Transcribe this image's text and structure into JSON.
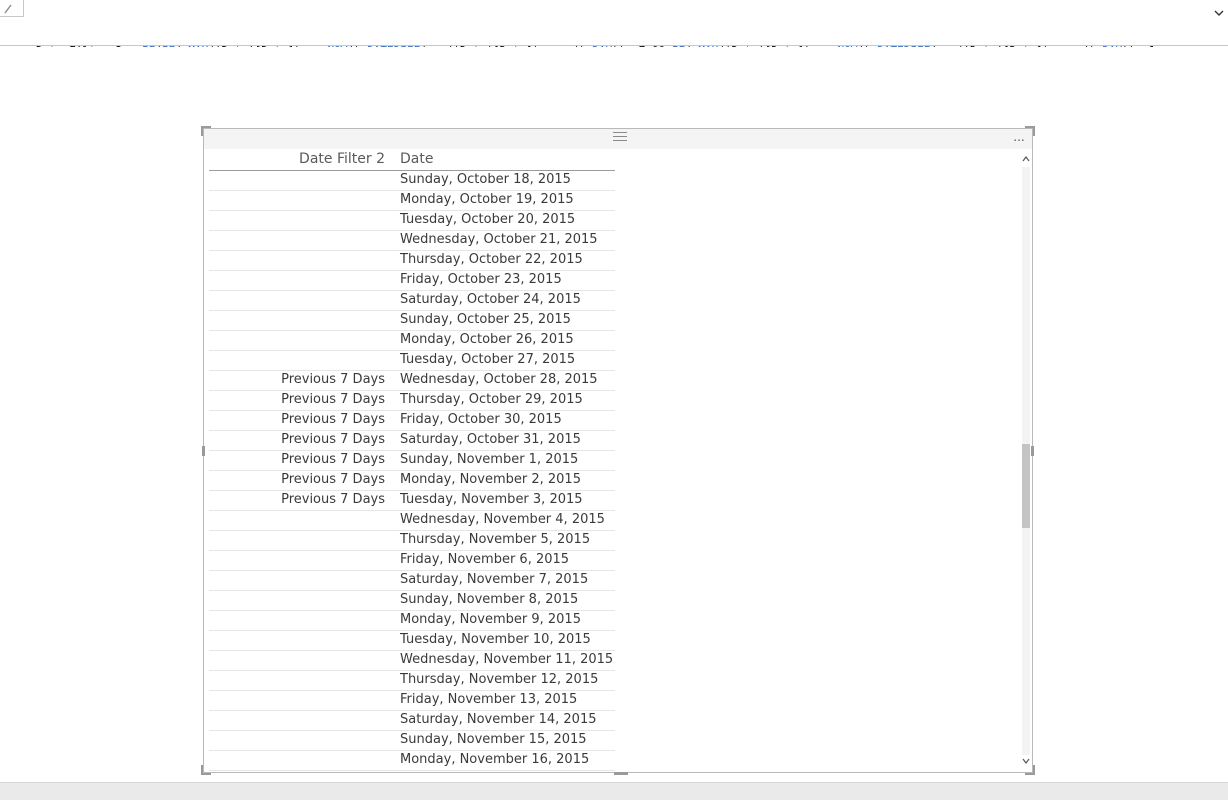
{
  "formula": {
    "line1_parts": [
      {
        "t": "Date Filter 2 = ",
        "c": "plain"
      },
      {
        "t": "IF",
        "c": "kw"
      },
      {
        "t": "(",
        "c": "plain"
      },
      {
        "t": "IF",
        "c": "kw"
      },
      {
        "t": "( ",
        "c": "plain"
      },
      {
        "t": "MAX",
        "c": "kw"
      },
      {
        "t": "('Date'[Date]) <= ",
        "c": "plain"
      },
      {
        "t": "NOW",
        "c": "kw"
      },
      {
        "t": "(),",
        "c": "plain"
      },
      {
        "t": "DATEDIFF",
        "c": "kw"
      },
      {
        "t": "(",
        "c": "plain"
      },
      {
        "t": "max",
        "c": "kw"
      },
      {
        "t": "('Date'[Date]), ",
        "c": "plain"
      },
      {
        "t": "now",
        "c": "kw"
      },
      {
        "t": "(),",
        "c": "plain"
      },
      {
        "t": "DAY",
        "c": "kw"
      },
      {
        "t": "))<=7 && ",
        "c": "plain"
      },
      {
        "t": "IF",
        "c": "kw"
      },
      {
        "t": "( ",
        "c": "plain"
      },
      {
        "t": "MAX",
        "c": "kw"
      },
      {
        "t": "('Date'[Date]) <= ",
        "c": "plain"
      },
      {
        "t": "NOW",
        "c": "kw"
      },
      {
        "t": "(),",
        "c": "plain"
      },
      {
        "t": "DATEDIFF",
        "c": "kw"
      },
      {
        "t": "(",
        "c": "plain"
      },
      {
        "t": "max",
        "c": "kw"
      },
      {
        "t": "('Date'[Date]), ",
        "c": "plain"
      },
      {
        "t": "now",
        "c": "kw"
      },
      {
        "t": "(),",
        "c": "plain"
      },
      {
        "t": "DAY",
        "c": "kw"
      },
      {
        "t": "))>=1,",
        "c": "plain"
      }
    ],
    "line2_parts": [
      {
        "t": "\"Previous 7 Days\",\"\"",
        "c": "str"
      },
      {
        "t": ")",
        "c": "plain"
      }
    ]
  },
  "table": {
    "headers": [
      "Date Filter 2",
      "Date"
    ],
    "rows": [
      [
        "",
        "Sunday, October 18, 2015"
      ],
      [
        "",
        "Monday, October 19, 2015"
      ],
      [
        "",
        "Tuesday, October 20, 2015"
      ],
      [
        "",
        "Wednesday, October 21, 2015"
      ],
      [
        "",
        "Thursday, October 22, 2015"
      ],
      [
        "",
        "Friday, October 23, 2015"
      ],
      [
        "",
        "Saturday, October 24, 2015"
      ],
      [
        "",
        "Sunday, October 25, 2015"
      ],
      [
        "",
        "Monday, October 26, 2015"
      ],
      [
        "",
        "Tuesday, October 27, 2015"
      ],
      [
        "Previous 7 Days",
        "Wednesday, October 28, 2015"
      ],
      [
        "Previous 7 Days",
        "Thursday, October 29, 2015"
      ],
      [
        "Previous 7 Days",
        "Friday, October 30, 2015"
      ],
      [
        "Previous 7 Days",
        "Saturday, October 31, 2015"
      ],
      [
        "Previous 7 Days",
        "Sunday, November 1, 2015"
      ],
      [
        "Previous 7 Days",
        "Monday, November 2, 2015"
      ],
      [
        "Previous 7 Days",
        "Tuesday, November 3, 2015"
      ],
      [
        "",
        "Wednesday, November 4, 2015"
      ],
      [
        "",
        "Thursday, November 5, 2015"
      ],
      [
        "",
        "Friday, November 6, 2015"
      ],
      [
        "",
        "Saturday, November 7, 2015"
      ],
      [
        "",
        "Sunday, November 8, 2015"
      ],
      [
        "",
        "Monday, November 9, 2015"
      ],
      [
        "",
        "Tuesday, November 10, 2015"
      ],
      [
        "",
        "Wednesday, November 11, 2015"
      ],
      [
        "",
        "Thursday, November 12, 2015"
      ],
      [
        "",
        "Friday, November 13, 2015"
      ],
      [
        "",
        "Saturday, November 14, 2015"
      ],
      [
        "",
        "Sunday, November 15, 2015"
      ],
      [
        "",
        "Monday, November 16, 2015"
      ]
    ]
  },
  "visual": {
    "more_options_label": "...",
    "scroll_position": 0.55
  },
  "colors": {
    "keyword": "#3a6fc4",
    "string": "#a31515",
    "header_text": "#5a5a5a",
    "cell_text": "#3a3a3a"
  }
}
